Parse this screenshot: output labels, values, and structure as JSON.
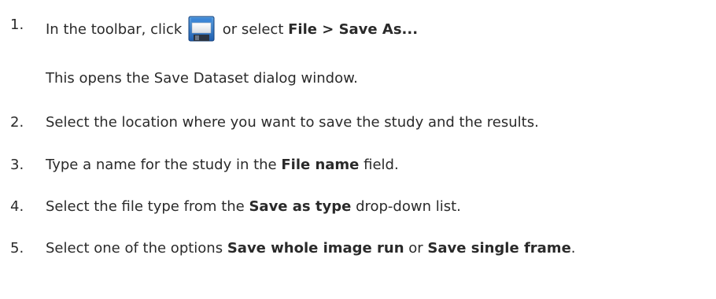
{
  "steps": [
    {
      "number": "1.",
      "pre": "In the toolbar, click",
      "icon": "floppy-disk-save-icon",
      "mid": " or select ",
      "menu_path": "File > Save As...",
      "note": "This opens the Save Dataset dialog window."
    },
    {
      "number": "2.",
      "text": "Select the location where you want to save the study and the results."
    },
    {
      "number": "3.",
      "pre": "Type a name for the study in the ",
      "bold": "File name",
      "post": " field."
    },
    {
      "number": "4.",
      "pre": "Select the file type from the ",
      "bold": "Save as type",
      "post": " drop-down list."
    },
    {
      "number": "5.",
      "pre": "Select one of the options ",
      "bold1": "Save whole image run",
      "mid": " or ",
      "bold2": "Save single frame",
      "post": "."
    }
  ]
}
